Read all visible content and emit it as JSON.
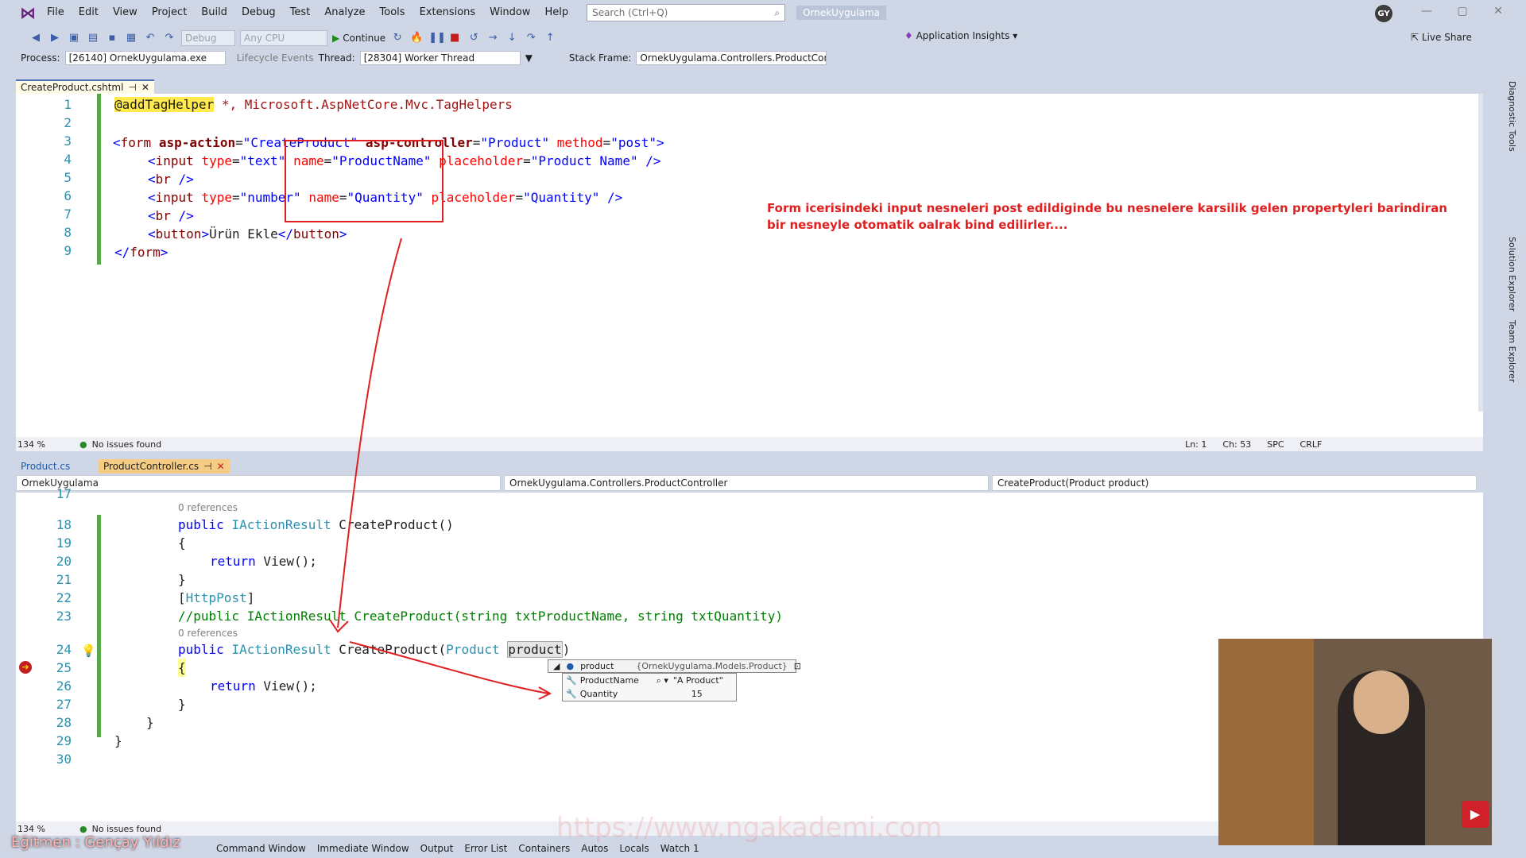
{
  "menu": {
    "items": [
      "File",
      "Edit",
      "View",
      "Project",
      "Build",
      "Debug",
      "Test",
      "Analyze",
      "Tools",
      "Extensions",
      "Window",
      "Help"
    ],
    "search_placeholder": "Search (Ctrl+Q)",
    "solution_name": "OrnekUygulama",
    "user_initials": "GY"
  },
  "toolbar": {
    "config": "Debug",
    "platform": "Any CPU",
    "continue_label": "Continue",
    "app_insights": "Application Insights",
    "live_share": "Live Share"
  },
  "debugbar": {
    "process_label": "Process:",
    "process_value": "[26140] OrnekUygulama.exe",
    "lifecycle_label": "Lifecycle Events",
    "thread_label": "Thread:",
    "thread_value": "[28304] Worker Thread",
    "stack_label": "Stack Frame:",
    "stack_value": "OrnekUygulama.Controllers.ProductContr"
  },
  "top_editor": {
    "tab": "CreateProduct.cshtml",
    "zoom": "134 %",
    "issues": "No issues found",
    "ln": "Ln: 1",
    "ch": "Ch: 53",
    "spc": "SPC",
    "crlf": "CRLF",
    "lines": [
      {
        "n": "1"
      },
      {
        "n": "2"
      },
      {
        "n": "3"
      },
      {
        "n": "4"
      },
      {
        "n": "5"
      },
      {
        "n": "6"
      },
      {
        "n": "7"
      },
      {
        "n": "8"
      },
      {
        "n": "9"
      }
    ]
  },
  "annotation": "Form icerisindeki input nesneleri post edildiginde bu nesnelere karsilik gelen propertyleri barindiran bir nesneyle otomatik oalrak bind edilirler....",
  "bottom_editor": {
    "tabs": [
      "Product.cs",
      "ProductController.cs"
    ],
    "nav_project": "OrnekUygulama",
    "nav_class": "OrnekUygulama.Controllers.ProductController",
    "nav_member": "CreateProduct(Product product)",
    "zoom": "134 %",
    "issues": "No issues found",
    "refs_a": "0 references",
    "refs_b": "0 references",
    "line_numbers": [
      "17",
      "18",
      "19",
      "20",
      "21",
      "22",
      "23",
      "24",
      "25",
      "26",
      "27",
      "28",
      "29",
      "30"
    ]
  },
  "datatip": {
    "name": "product",
    "type": "{OrnekUygulama.Models.Product}",
    "rows": [
      {
        "name": "ProductName",
        "value": "\"A Product\""
      },
      {
        "name": "Quantity",
        "value": "15"
      }
    ]
  },
  "bottom_tools": [
    "Command Window",
    "Immediate Window",
    "Output",
    "Error List",
    "Containers",
    "Autos",
    "Locals",
    "Watch 1"
  ],
  "right_rail": [
    "Diagnostic Tools",
    "Solution Explorer",
    "Team Explorer"
  ],
  "instructor": "Eğitmen : Gençay Yıldız",
  "watermark": "https://www.ngakademi.com"
}
